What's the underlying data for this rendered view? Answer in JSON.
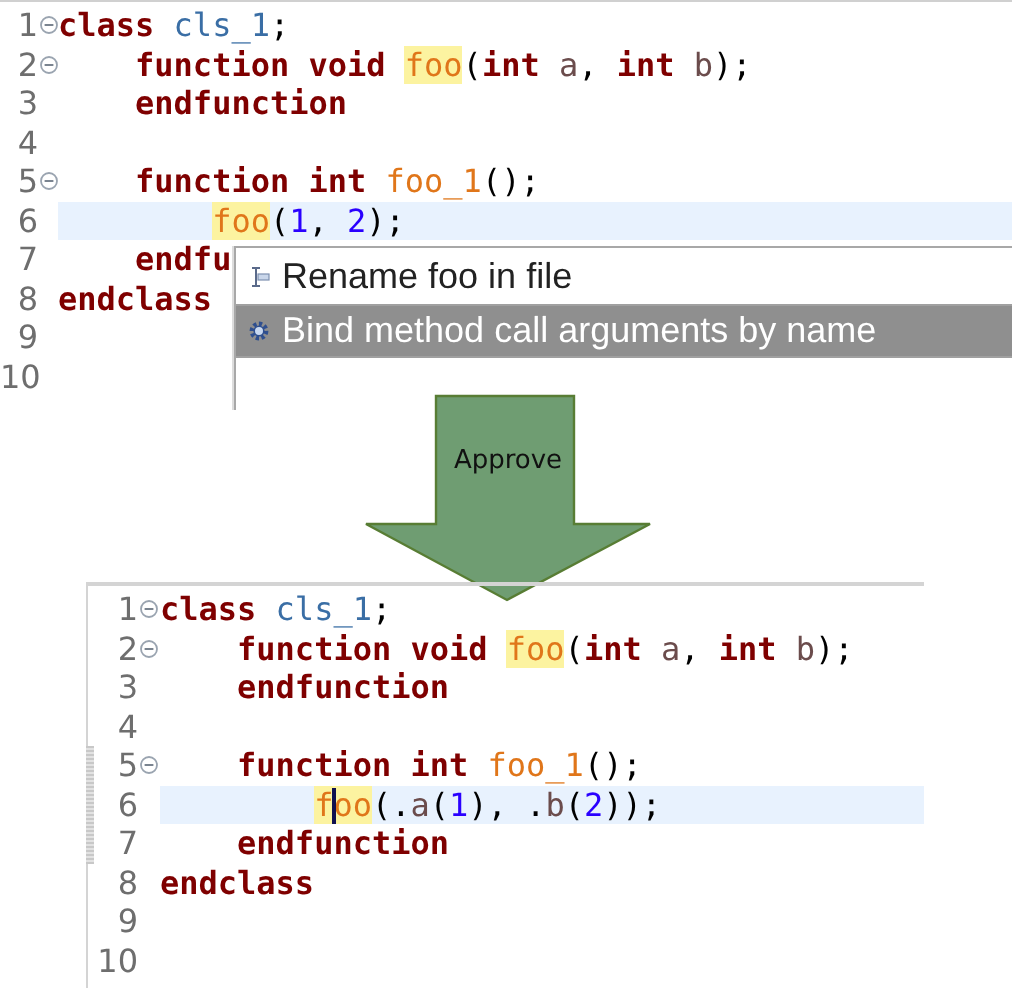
{
  "top_editor": {
    "lines": [
      {
        "number": "1",
        "fold": true,
        "current": false,
        "tokens": [
          {
            "text": "class ",
            "kind": "kw"
          },
          {
            "text": "cls_1",
            "kind": "type"
          },
          {
            "text": ";",
            "kind": "punct"
          }
        ]
      },
      {
        "number": "2",
        "fold": true,
        "current": false,
        "tokens": [
          {
            "text": "    function void ",
            "kind": "kw"
          },
          {
            "text": "foo",
            "kind": "fn",
            "occurrence": true
          },
          {
            "text": "(",
            "kind": "punct"
          },
          {
            "text": "int ",
            "kind": "kw"
          },
          {
            "text": "a",
            "kind": "param"
          },
          {
            "text": ", ",
            "kind": "punct"
          },
          {
            "text": "int ",
            "kind": "kw"
          },
          {
            "text": "b",
            "kind": "param"
          },
          {
            "text": ");",
            "kind": "punct"
          }
        ]
      },
      {
        "number": "3",
        "fold": false,
        "current": false,
        "tokens": [
          {
            "text": "    endfunction",
            "kind": "kw"
          }
        ]
      },
      {
        "number": "4",
        "fold": false,
        "current": false
      },
      {
        "number": "5",
        "fold": true,
        "current": false,
        "tokens": [
          {
            "text": "    function int ",
            "kind": "kw"
          },
          {
            "text": "foo_1",
            "kind": "fn"
          },
          {
            "text": "();",
            "kind": "punct"
          }
        ]
      },
      {
        "number": "6",
        "fold": false,
        "current": true,
        "kind": "nested",
        "tokens": [
          {
            "text": "foo",
            "kind": "fn",
            "occurrence": true
          },
          {
            "text": "(",
            "kind": "punct"
          },
          {
            "text": "1",
            "kind": "num"
          },
          {
            "text": ", ",
            "kind": "punct"
          },
          {
            "text": "2",
            "kind": "num"
          },
          {
            "text": ");",
            "kind": "punct"
          }
        ]
      },
      {
        "number": "7",
        "fold": false,
        "current": false,
        "tokens": [
          {
            "text": "    endfu",
            "kind": "kw"
          }
        ]
      },
      {
        "number": "8",
        "fold": false,
        "current": false,
        "tokens": [
          {
            "text": "endclass",
            "kind": "kw"
          }
        ]
      },
      {
        "number": "9",
        "fold": false,
        "current": false
      },
      {
        "number": "10",
        "fold": false,
        "current": false
      }
    ]
  },
  "popup": {
    "items": [
      {
        "label": "Rename foo in file",
        "kind": "rename",
        "selected": false
      },
      {
        "label": "Bind method call arguments by name",
        "kind": "gear",
        "selected": true
      }
    ]
  },
  "arrow": {
    "label": "Approve"
  },
  "bottom_editor": {
    "lines": [
      {
        "number": "1",
        "fold": true,
        "current": false,
        "marked": false,
        "tokens": [
          {
            "text": "class ",
            "kind": "kw"
          },
          {
            "text": "cls_1",
            "kind": "type"
          },
          {
            "text": ";",
            "kind": "punct"
          }
        ]
      },
      {
        "number": "2",
        "fold": true,
        "current": false,
        "marked": false,
        "tokens": [
          {
            "text": "    function void ",
            "kind": "kw"
          },
          {
            "text": "foo",
            "kind": "fn",
            "occurrence": true
          },
          {
            "text": "(",
            "kind": "punct"
          },
          {
            "text": "int ",
            "kind": "kw"
          },
          {
            "text": "a",
            "kind": "param"
          },
          {
            "text": ", ",
            "kind": "punct"
          },
          {
            "text": "int ",
            "kind": "kw"
          },
          {
            "text": "b",
            "kind": "param"
          },
          {
            "text": ");",
            "kind": "punct"
          }
        ]
      },
      {
        "number": "3",
        "fold": false,
        "current": false,
        "marked": false,
        "tokens": [
          {
            "text": "    endfunction",
            "kind": "kw"
          }
        ]
      },
      {
        "number": "4",
        "fold": false,
        "current": false,
        "marked": false
      },
      {
        "number": "5",
        "fold": true,
        "current": false,
        "marked": true,
        "tokens": [
          {
            "text": "    function int ",
            "kind": "kw"
          },
          {
            "text": "foo_1",
            "kind": "fn"
          },
          {
            "text": "();",
            "kind": "punct"
          }
        ]
      },
      {
        "number": "6",
        "fold": false,
        "current": true,
        "marked": true,
        "kind": "nested",
        "tokens": [
          {
            "text": "f",
            "kind": "fn",
            "occurrence": true
          },
          {
            "kind": "caret"
          },
          {
            "text": "oo",
            "kind": "fn",
            "occurrence": true
          },
          {
            "text": "(.",
            "kind": "punct"
          },
          {
            "text": "a",
            "kind": "param"
          },
          {
            "text": "(",
            "kind": "punct"
          },
          {
            "text": "1",
            "kind": "num"
          },
          {
            "text": "), .",
            "kind": "punct"
          },
          {
            "text": "b",
            "kind": "param"
          },
          {
            "text": "(",
            "kind": "punct"
          },
          {
            "text": "2",
            "kind": "num"
          },
          {
            "text": "));",
            "kind": "punct"
          }
        ]
      },
      {
        "number": "7",
        "fold": false,
        "current": false,
        "marked": true,
        "tokens": [
          {
            "text": "    endfunction",
            "kind": "kw"
          }
        ]
      },
      {
        "number": "8",
        "fold": false,
        "current": false,
        "marked": false,
        "tokens": [
          {
            "text": "endclass",
            "kind": "kw"
          }
        ]
      },
      {
        "number": "9",
        "fold": false,
        "current": false,
        "marked": false
      },
      {
        "number": "10",
        "fold": false,
        "current": false,
        "marked": false
      }
    ]
  }
}
